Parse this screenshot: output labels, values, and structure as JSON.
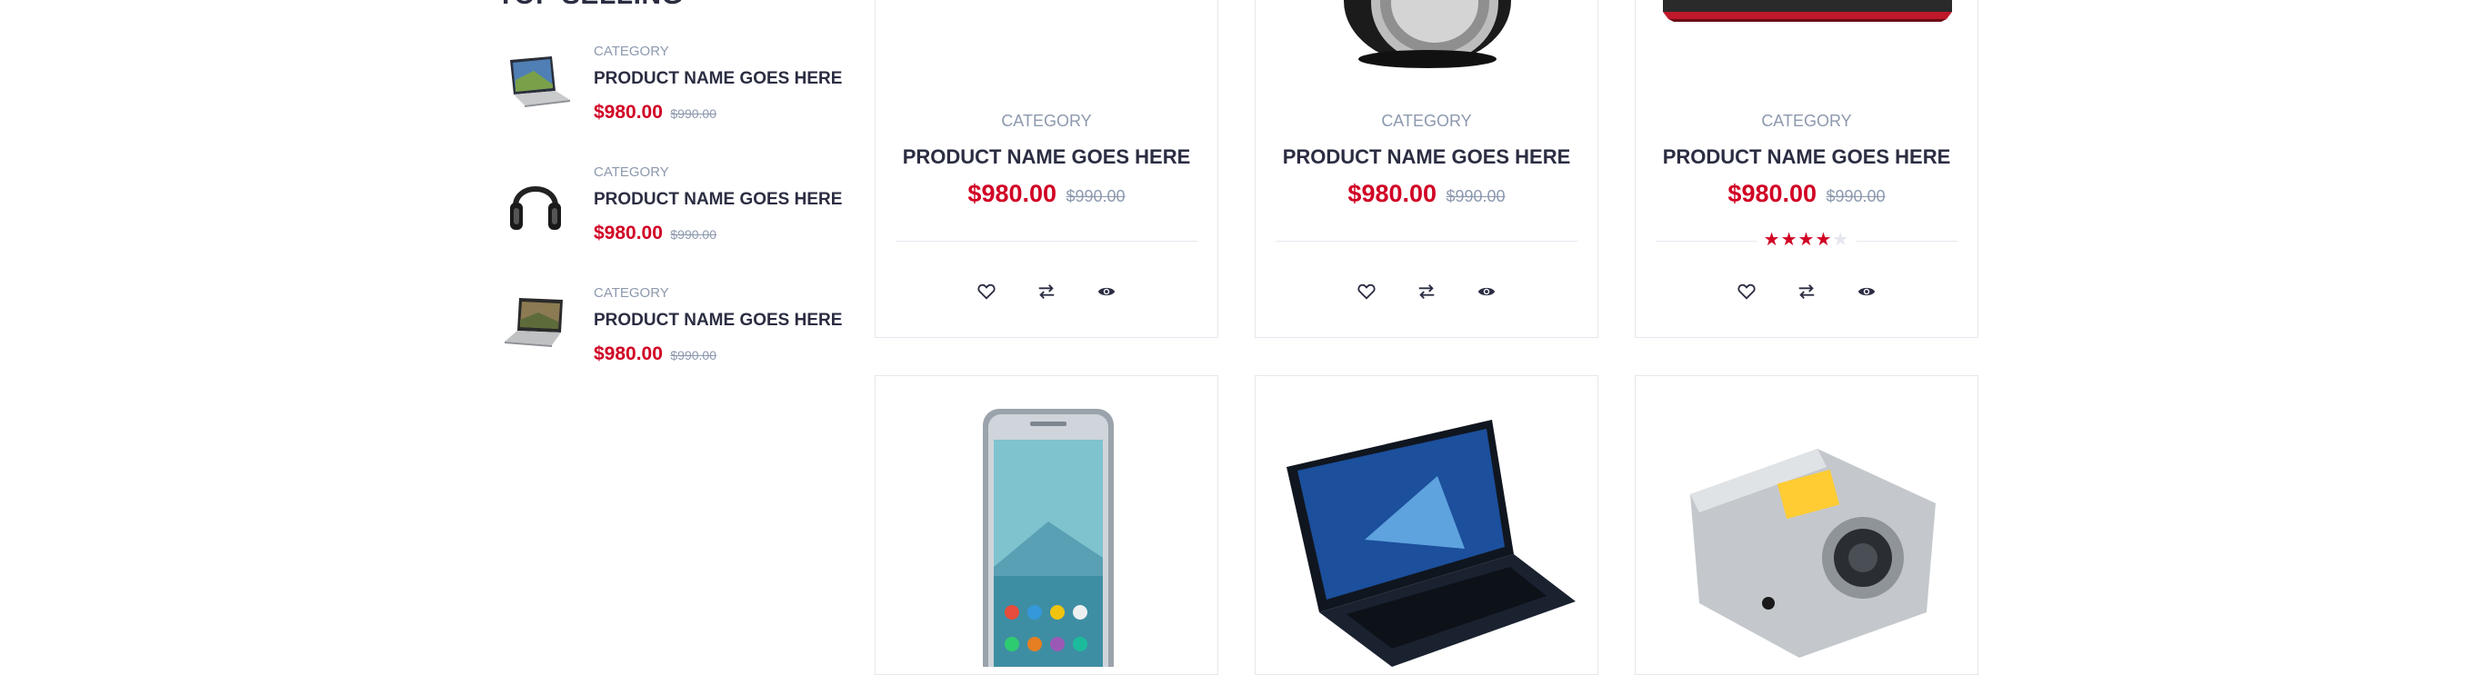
{
  "section": {
    "title": "TOP SELLING"
  },
  "widget_products": [
    {
      "category": "CATEGORY",
      "name": "PRODUCT NAME GOES HERE",
      "price": "$980.00",
      "old_price": "$990.00",
      "image": "laptop-silver"
    },
    {
      "category": "CATEGORY",
      "name": "PRODUCT NAME GOES HERE",
      "price": "$980.00",
      "old_price": "$990.00",
      "image": "headphones"
    },
    {
      "category": "CATEGORY",
      "name": "PRODUCT NAME GOES HERE",
      "price": "$980.00",
      "old_price": "$990.00",
      "image": "laptop-open"
    }
  ],
  "products": [
    {
      "category": "CATEGORY",
      "name": "PRODUCT NAME GOES HERE",
      "price": "$980.00",
      "old_price": "$990.00",
      "rating": null
    },
    {
      "category": "CATEGORY",
      "name": "PRODUCT NAME GOES HERE",
      "price": "$980.00",
      "old_price": "$990.00",
      "rating": null,
      "image": "speaker"
    },
    {
      "category": "CATEGORY",
      "name": "PRODUCT NAME GOES HERE",
      "price": "$980.00",
      "old_price": "$990.00",
      "rating": 4,
      "rating_max": 5,
      "image": "laptop-red"
    }
  ],
  "bottom_products": [
    {
      "image": "smartphone"
    },
    {
      "image": "asus-laptop"
    },
    {
      "image": "digital-camera"
    }
  ],
  "actions": [
    "heart-icon",
    "exchange-icon",
    "eye-icon"
  ],
  "colors": {
    "accent": "#D10024",
    "text": "#2B2D42",
    "muted": "#8D99AE",
    "border": "#E4E7ED"
  }
}
